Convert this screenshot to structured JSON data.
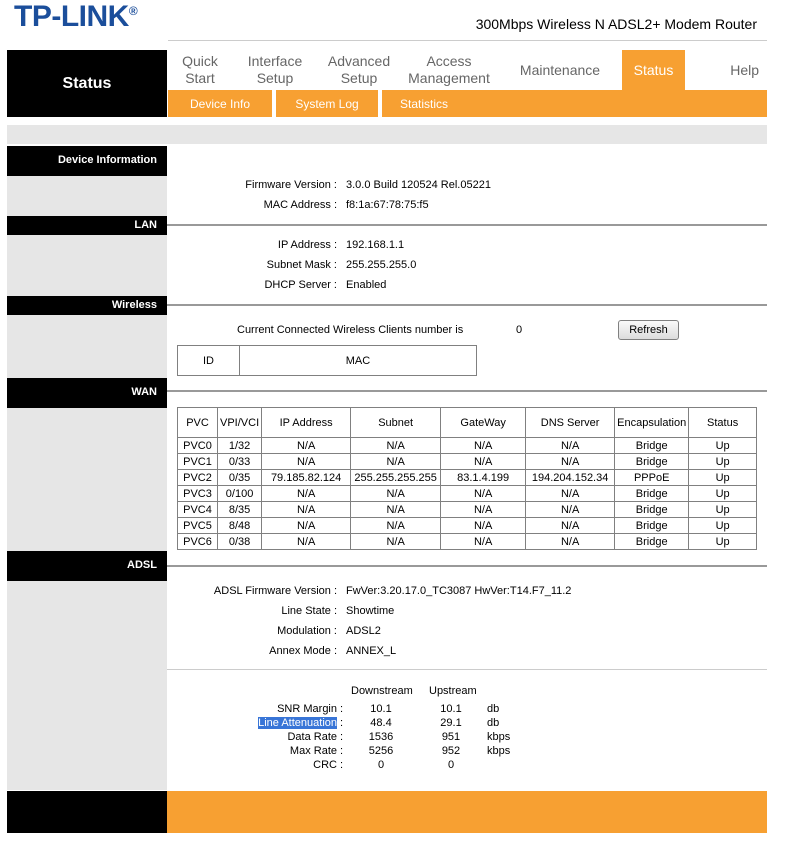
{
  "brand": {
    "logo": "TP-LINK",
    "registered": "®",
    "product": "300Mbps Wireless N ADSL2+ Modem Router"
  },
  "colors": {
    "accent": "#f7a032",
    "dark": "#000000",
    "panel": "#e6e6e6",
    "logo": "#1b4e9b"
  },
  "page_title": "Status",
  "nav": [
    {
      "line1": "Quick",
      "line2": "Start"
    },
    {
      "line1": "Interface",
      "line2": "Setup"
    },
    {
      "line1": "Advanced",
      "line2": "Setup"
    },
    {
      "line1": "Access",
      "line2": "Management"
    },
    {
      "line1": "Maintenance",
      "line2": ""
    },
    {
      "line1": "Status",
      "line2": ""
    },
    {
      "line1": "Help",
      "line2": ""
    }
  ],
  "subnav": [
    "Device Info",
    "System Log",
    "Statistics"
  ],
  "sections": {
    "device": "Device Information",
    "lan": "LAN",
    "wireless": "Wireless",
    "wan": "WAN",
    "adsl": "ADSL"
  },
  "device": {
    "fw_label": "Firmware Version :",
    "fw_value": "3.0.0 Build 120524 Rel.05221",
    "mac_label": "MAC Address :",
    "mac_value": "f8:1a:67:78:75:f5"
  },
  "lan": {
    "ip_label": "IP Address :",
    "ip_value": "192.168.1.1",
    "mask_label": "Subnet Mask :",
    "mask_value": "255.255.255.0",
    "dhcp_label": "DHCP Server :",
    "dhcp_value": "Enabled"
  },
  "wireless": {
    "clients_label": "Current Connected Wireless Clients number is",
    "clients_value": "0",
    "refresh": "Refresh",
    "col_id": "ID",
    "col_mac": "MAC"
  },
  "wan": {
    "headers": [
      "PVC",
      "VPI/VCI",
      "IP Address",
      "Subnet",
      "GateWay",
      "DNS Server",
      "Encapsulation",
      "Status"
    ],
    "rows": [
      [
        "PVC0",
        "1/32",
        "N/A",
        "N/A",
        "N/A",
        "N/A",
        "Bridge",
        "Up"
      ],
      [
        "PVC1",
        "0/33",
        "N/A",
        "N/A",
        "N/A",
        "N/A",
        "Bridge",
        "Up"
      ],
      [
        "PVC2",
        "0/35",
        "79.185.82.124",
        "255.255.255.255",
        "83.1.4.199",
        "194.204.152.34",
        "PPPoE",
        "Up"
      ],
      [
        "PVC3",
        "0/100",
        "N/A",
        "N/A",
        "N/A",
        "N/A",
        "Bridge",
        "Up"
      ],
      [
        "PVC4",
        "8/35",
        "N/A",
        "N/A",
        "N/A",
        "N/A",
        "Bridge",
        "Up"
      ],
      [
        "PVC5",
        "8/48",
        "N/A",
        "N/A",
        "N/A",
        "N/A",
        "Bridge",
        "Up"
      ],
      [
        "PVC6",
        "0/38",
        "N/A",
        "N/A",
        "N/A",
        "N/A",
        "Bridge",
        "Up"
      ]
    ]
  },
  "adsl": {
    "fw_label": "ADSL Firmware Version :",
    "fw_value": "FwVer:3.20.17.0_TC3087 HwVer:T14.F7_11.2",
    "state_label": "Line State :",
    "state_value": "Showtime",
    "mod_label": "Modulation :",
    "mod_value": "ADSL2",
    "annex_label": "Annex Mode :",
    "annex_value": "ANNEX_L",
    "col_down": "Downstream",
    "col_up": "Upstream",
    "stats": [
      {
        "label": "SNR Margin",
        "sep": ":",
        "down": "10.1",
        "up": "10.1",
        "unit": "db"
      },
      {
        "label": "Line Attenuation",
        "sep": ":",
        "down": "48.4",
        "up": "29.1",
        "unit": "db"
      },
      {
        "label": "Data Rate",
        "sep": ":",
        "down": "1536",
        "up": "951",
        "unit": "kbps"
      },
      {
        "label": "Max Rate",
        "sep": ":",
        "down": "5256",
        "up": "952",
        "unit": "kbps"
      },
      {
        "label": "CRC",
        "sep": ":",
        "down": "0",
        "up": "0",
        "unit": ""
      }
    ]
  }
}
